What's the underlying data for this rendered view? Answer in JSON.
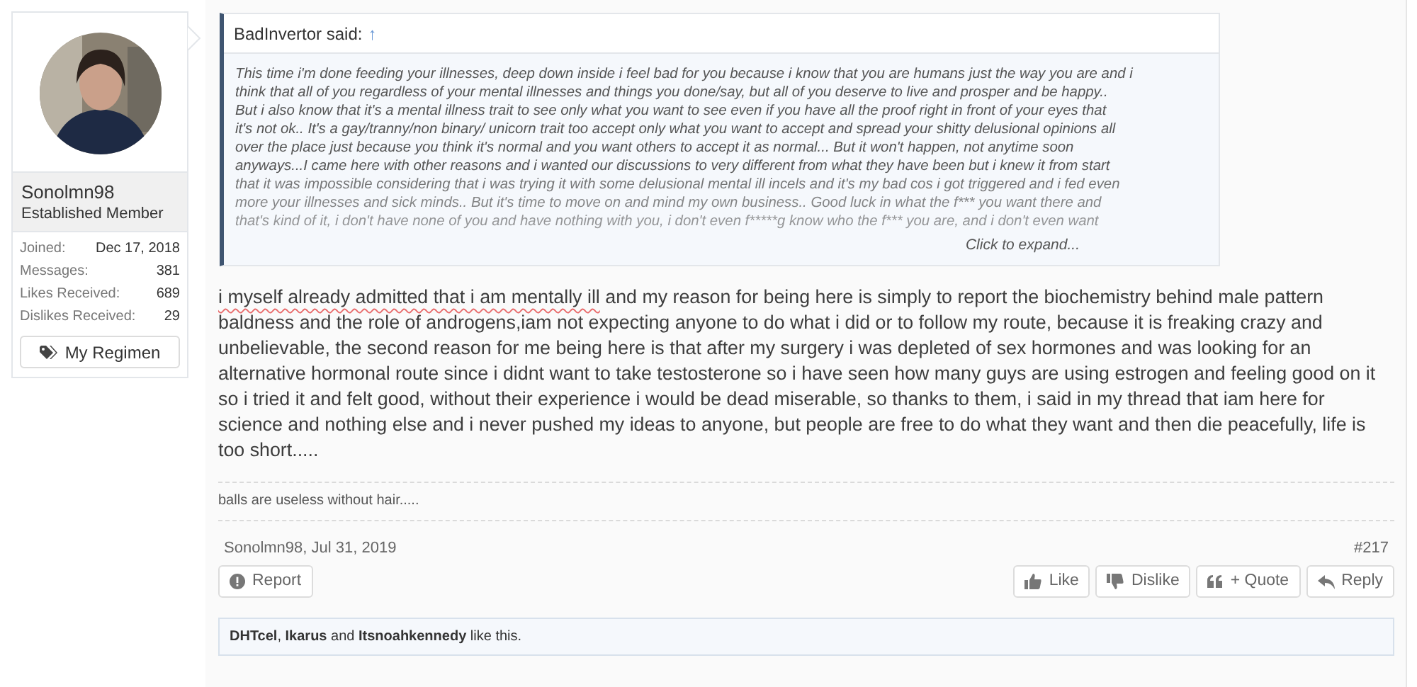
{
  "user": {
    "name": "Sonolmn98",
    "title": "Established Member",
    "stats": [
      {
        "label": "Joined:",
        "value": "Dec 17, 2018"
      },
      {
        "label": "Messages:",
        "value": "381"
      },
      {
        "label": "Likes Received:",
        "value": "689"
      },
      {
        "label": "Dislikes Received:",
        "value": "29"
      }
    ],
    "button": "My Regimen"
  },
  "quote": {
    "author": "BadInvertor said:",
    "jump": "↑",
    "lines": [
      "This time i'm done feeding your illnesses, deep down inside i feel bad for you because i know that you are humans just the way you are and i",
      "think that all of you regardless of your mental illnesses and things you done/say, but all of you deserve to live and prosper and be happy..",
      "But i also know that it's a mental illness trait to see only what you want to see even if you have all the proof right in front of your eyes that",
      "it's not ok.. It's a gay/tranny/non binary/ unicorn trait too accept only what you want to accept and spread your shitty delusional opinions all",
      "over the place just because you think it's normal and you want others to accept it as normal... But it won't happen, not anytime soon",
      "anyways...I came here with other reasons and i wanted our discussions to very different from what they have been but i knew it from start",
      "that it was impossible considering that i was trying it with some delusional mental ill incels and it's my bad cos i got triggered and i fed even",
      "more your illnesses and sick minds.. But it's time to move on and mind my own business.. Good luck in what the f*** you want there and",
      "that's kind of it, i don't have none of you and have nothing with you, i don't even f*****g know who the f*** you are, and i don't even want"
    ],
    "expand": "Click to expand..."
  },
  "message_underlined": "i myself already admitted that i am mentally ill",
  "message_lines": [
    " and my reason for being here is simply to report the biochemistry behind male pattern",
    "baldness and the role of androgens,iam not expecting anyone to do what i did or to follow my route, because it is freaking crazy and",
    "unbelievable, the second reason for me being here is that after my surgery i was depleted of sex hormones and was looking for an",
    "alternative hormonal route since i didnt want to take testosterone so i have seen how many guys are using estrogen and feeling good on it",
    "so i tried it and felt good, without their experience i would be dead miserable, so thanks to them, i said in my thread that iam here for",
    "science and nothing else and i never pushed my ideas to anyone, but people are free to do what they want and then die peacefully, life is",
    "too short....."
  ],
  "signature": "balls are useless without hair.....",
  "meta": {
    "author_date": "Sonolmn98, Jul 31, 2019",
    "post_number": "#217"
  },
  "actions_left": [
    {
      "kind": "report",
      "label": "Report"
    }
  ],
  "actions_right": [
    {
      "kind": "like",
      "label": "Like"
    },
    {
      "kind": "dislike",
      "label": "Dislike"
    },
    {
      "kind": "quote",
      "label": "+ Quote"
    },
    {
      "kind": "reply",
      "label": "Reply"
    }
  ],
  "likes": "**DHTcel**, **Ikarus** and **Itsnoahkennedy** like this."
}
